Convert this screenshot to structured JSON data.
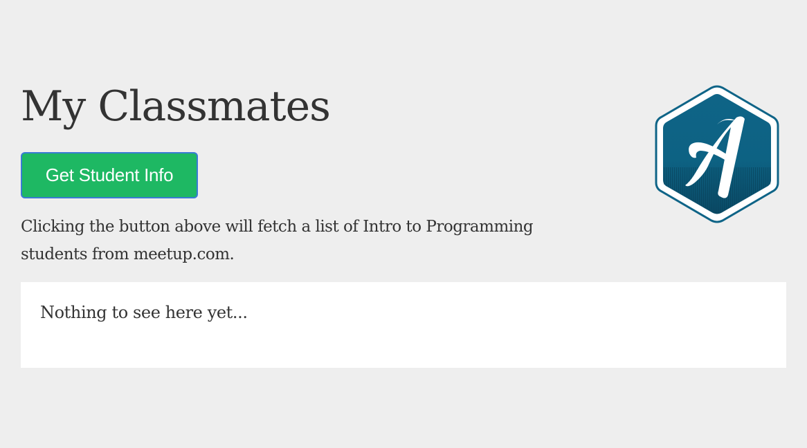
{
  "page": {
    "title": "My Classmates",
    "fetch_button_label": "Get Student Info",
    "description": "Clicking the button above will fetch a list of Intro to Programming students from meetup.com.",
    "results_placeholder": "Nothing to see here yet..."
  },
  "logo": {
    "icon": "hexagon-letter-a-logo",
    "letter": "A"
  },
  "colors": {
    "background": "#eeeeee",
    "button": "#1eb863",
    "button_border": "#3a7bd5",
    "logo_blue": "#0f6487",
    "logo_dark": "#0d4a63",
    "panel": "#ffffff",
    "text": "#333333"
  }
}
